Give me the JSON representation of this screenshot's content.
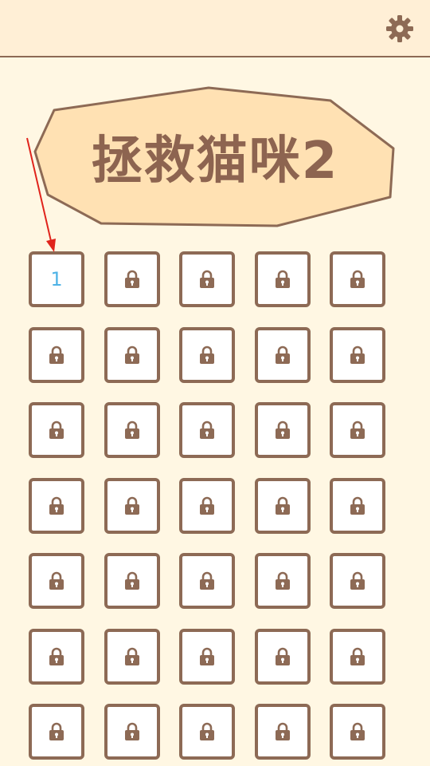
{
  "title": "拯救猫咪2",
  "colors": {
    "brown": "#8d6a55",
    "banner_fill": "#ffe1b3",
    "background": "#fff7e3",
    "topbar": "#ffefd6",
    "level_number": "#4fb3e6",
    "annotation_arrow": "#e0241c"
  },
  "settings": {
    "icon": "gear-icon"
  },
  "levels": [
    {
      "label": "1",
      "locked": false
    },
    {
      "locked": true
    },
    {
      "locked": true
    },
    {
      "locked": true
    },
    {
      "locked": true
    },
    {
      "locked": true
    },
    {
      "locked": true
    },
    {
      "locked": true
    },
    {
      "locked": true
    },
    {
      "locked": true
    },
    {
      "locked": true
    },
    {
      "locked": true
    },
    {
      "locked": true
    },
    {
      "locked": true
    },
    {
      "locked": true
    },
    {
      "locked": true
    },
    {
      "locked": true
    },
    {
      "locked": true
    },
    {
      "locked": true
    },
    {
      "locked": true
    },
    {
      "locked": true
    },
    {
      "locked": true
    },
    {
      "locked": true
    },
    {
      "locked": true
    },
    {
      "locked": true
    },
    {
      "locked": true
    },
    {
      "locked": true
    },
    {
      "locked": true
    },
    {
      "locked": true
    },
    {
      "locked": true
    },
    {
      "locked": true
    },
    {
      "locked": true
    },
    {
      "locked": true
    },
    {
      "locked": true
    },
    {
      "locked": true
    }
  ],
  "lock_icon": "lock-icon"
}
